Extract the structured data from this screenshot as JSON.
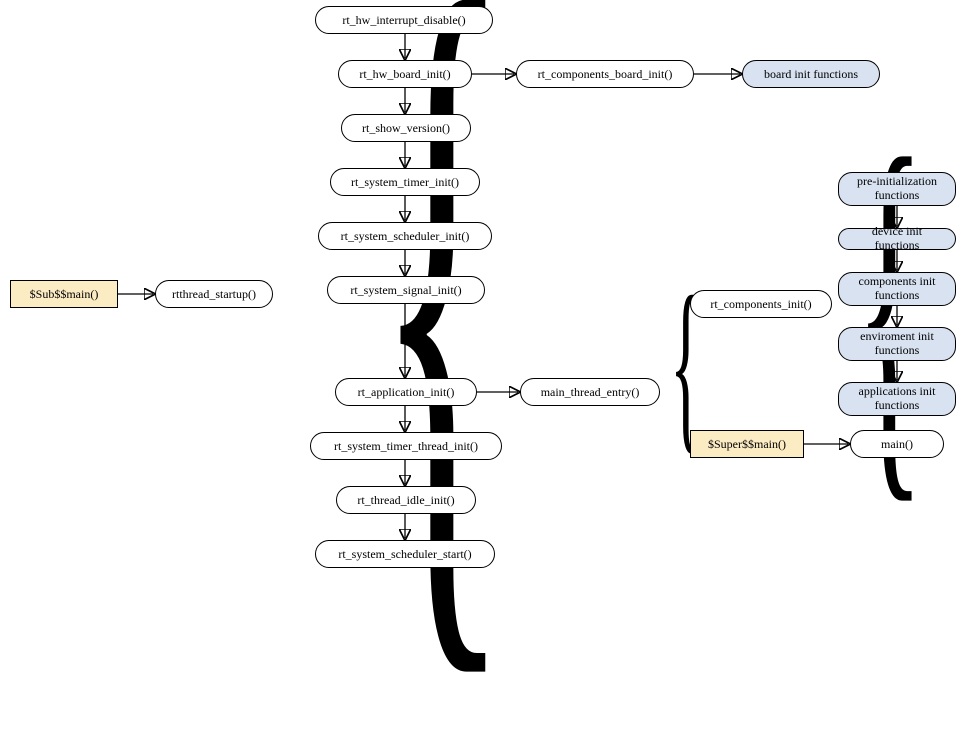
{
  "entry": {
    "sub_main": "$Sub$$main()",
    "rtthread_startup": "rtthread_startup()"
  },
  "startup_seq": {
    "disable_int": "rt_hw_interrupt_disable()",
    "board_init": "rt_hw_board_init()",
    "comp_board_init": "rt_components_board_init()",
    "board_init_funcs": "board init functions",
    "show_version": "rt_show_version()",
    "timer_init": "rt_system_timer_init()",
    "scheduler_init": "rt_system_scheduler_init()",
    "signal_init": "rt_system_signal_init()",
    "app_init": "rt_application_init()",
    "timer_thread_init": "rt_system_timer_thread_init()",
    "idle_init": "rt_thread_idle_init()",
    "scheduler_start": "rt_system_scheduler_start()"
  },
  "main_entry": "main_thread_entry()",
  "components": {
    "comp_init": "rt_components_init()",
    "pre_init": "pre-initialization functions",
    "device_init": "device init functions",
    "comp_init_funcs": "components init functions",
    "env_init": "enviroment init functions",
    "app_init_funcs": "applications init functions"
  },
  "super": {
    "super_main": "$Super$$main()",
    "main": "main()"
  }
}
